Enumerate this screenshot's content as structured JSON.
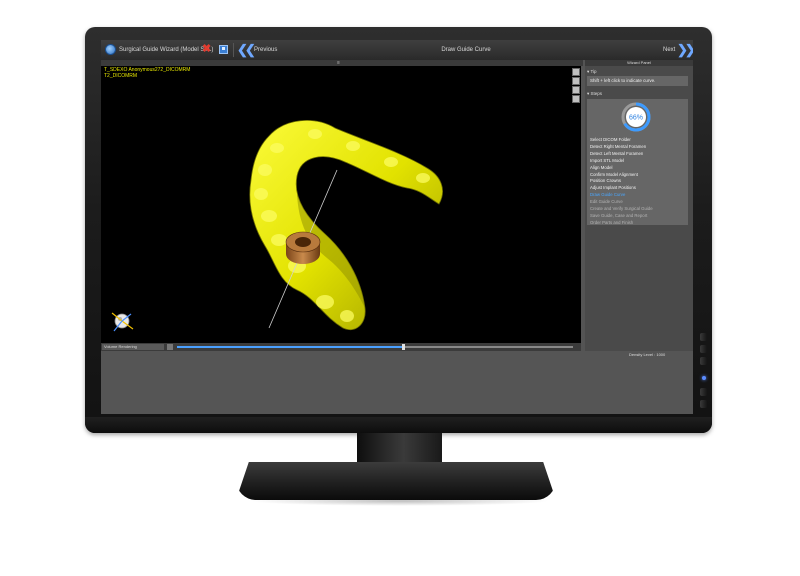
{
  "titlebar": {
    "app_title": "Surgical Guide Wizard (Model STL)",
    "center_title": "Draw Guide Curve",
    "previous_label": "Previous",
    "next_label": "Next"
  },
  "viewport": {
    "info_lines": [
      "T_SDEXO Anonymous272_DICOMRM",
      "T2_DICOMRM"
    ]
  },
  "sliderbar": {
    "mode_select": "Volume Rendering",
    "slider_fraction": 0.57
  },
  "status": {
    "density_level": "Density Level : 1000"
  },
  "wizard": {
    "title": "Wizard Panel",
    "tip_heading": "Tip",
    "tip_text": "Shift + left click to indicate curve.",
    "steps_heading": "Steps",
    "progress_label": "66%",
    "progress_fraction": 0.66,
    "steps": [
      {
        "label": "Select DICOM Folder",
        "state": "done"
      },
      {
        "label": "Detect Right Mental Foramen",
        "state": "done"
      },
      {
        "label": "Detect Left Mental Foramen",
        "state": "done"
      },
      {
        "label": "Import STL Model",
        "state": "done"
      },
      {
        "label": "Align Model",
        "state": "done"
      },
      {
        "label": "Confirm Model Alignment",
        "state": "done"
      },
      {
        "label": "Position Crowns",
        "state": "done"
      },
      {
        "label": "Adjust Implant Positions",
        "state": "done"
      },
      {
        "label": "Draw Guide Curve",
        "state": "current"
      },
      {
        "label": "Edit Guide Curve",
        "state": "future"
      },
      {
        "label": "Create and Verify Surgical Guide",
        "state": "future"
      },
      {
        "label": "Save Guide, Case and Report",
        "state": "future"
      },
      {
        "label": "Order Parts and Finish",
        "state": "future"
      }
    ]
  },
  "colors": {
    "accent": "#4aa7ff",
    "model": "#e8e800",
    "implant": "#b06a2e",
    "close": "#e03b2f"
  },
  "icons": {
    "app": "app-logo-icon",
    "close": "close-icon",
    "save": "save-icon",
    "previous": "double-chevron-left-icon",
    "next": "double-chevron-right-icon"
  }
}
